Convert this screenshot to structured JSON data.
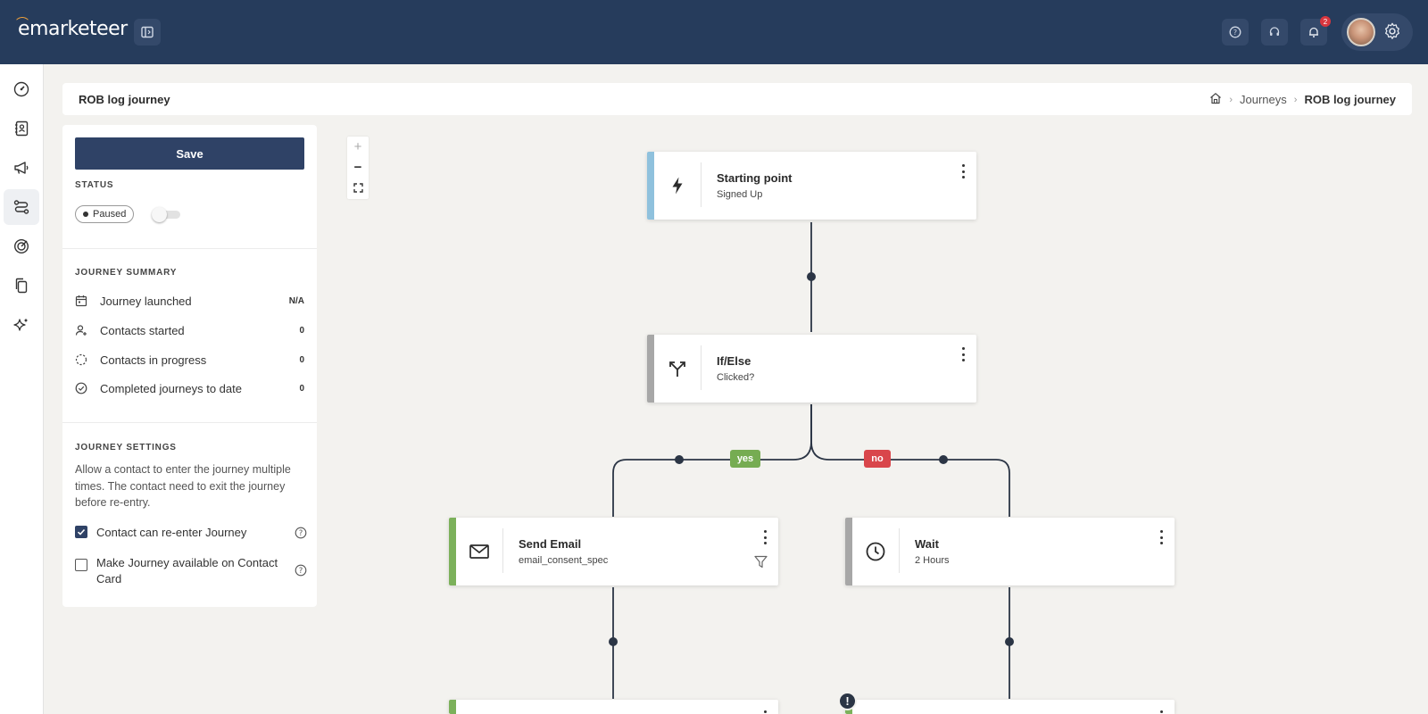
{
  "app": {
    "brand": "emarketeer"
  },
  "topbar": {
    "notification_count": "2"
  },
  "header": {
    "title": "ROB log journey",
    "breadcrumb": [
      "Journeys",
      "ROB log journey"
    ]
  },
  "panel": {
    "save_label": "Save",
    "status_label": "STATUS",
    "status_value": "Paused",
    "summary_label": "JOURNEY SUMMARY",
    "summary": [
      {
        "label": "Journey launched",
        "value": "N/A",
        "icon": "calendar-icon"
      },
      {
        "label": "Contacts started",
        "value": "0",
        "icon": "user-add-icon"
      },
      {
        "label": "Contacts in progress",
        "value": "0",
        "icon": "progress-icon"
      },
      {
        "label": "Completed journeys to date",
        "value": "0",
        "icon": "check-circle-icon"
      }
    ],
    "settings_label": "JOURNEY SETTINGS",
    "settings_desc": "Allow a contact to enter the journey multiple times. The contact need to exit the journey before re-entry.",
    "options": [
      {
        "label": "Contact can re-enter Journey",
        "checked": true
      },
      {
        "label": "Make Journey available on Contact Card",
        "checked": false
      }
    ]
  },
  "canvas": {
    "zoom_in": "+",
    "zoom_out": "−",
    "nodes": [
      {
        "title": "Starting point",
        "subtitle": "Signed Up",
        "accent": "#8fc1dd",
        "icon": "lightning-icon"
      },
      {
        "title": "If/Else",
        "subtitle": "Clicked?",
        "accent": "#a7a7a7",
        "icon": "split-icon"
      },
      {
        "title": "Send Email",
        "subtitle": "email_consent_spec",
        "accent": "#7cb15b",
        "icon": "mail-icon"
      },
      {
        "title": "Wait",
        "subtitle": "2 Hours",
        "accent": "#a7a7a7",
        "icon": "clock-icon"
      }
    ],
    "branches": [
      {
        "label": "yes",
        "color": "#76ac52"
      },
      {
        "label": "no",
        "color": "#d9464b"
      }
    ],
    "warning": "!"
  }
}
